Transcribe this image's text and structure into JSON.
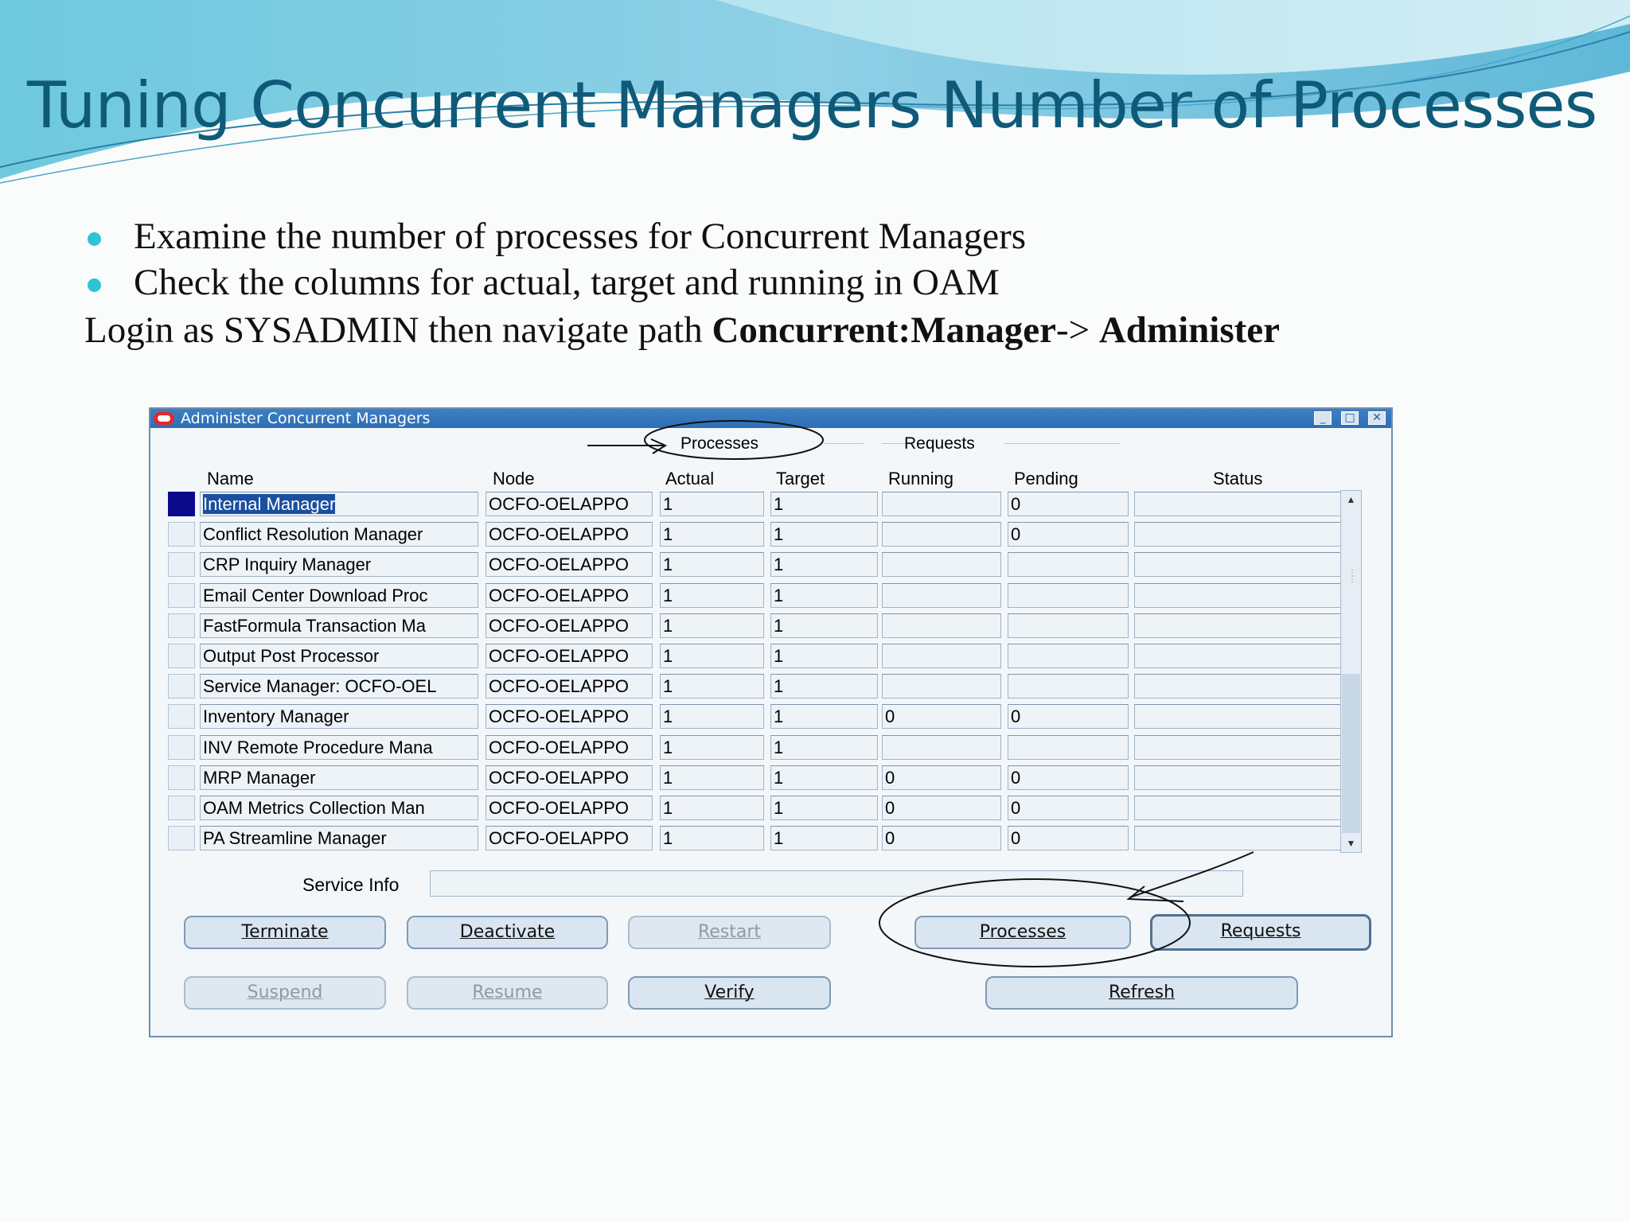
{
  "slide": {
    "title": "Tuning Concurrent Managers Number of Processes",
    "bullets": [
      "Examine the number of processes for Concurrent Managers",
      "Check  the columns for actual, target and running in OAM"
    ],
    "login_prefix": "Login as SYSADMIN then navigate path ",
    "login_bold1": "Concurrent:Manager",
    "login_arrow": "-> ",
    "login_bold2": "Administer"
  },
  "window": {
    "title": "Administer Concurrent Managers",
    "controls": {
      "minimize": "_",
      "maximize": "□",
      "close": "✕"
    }
  },
  "groups": {
    "processes": "Processes",
    "requests": "Requests"
  },
  "columns": {
    "name": "Name",
    "node": "Node",
    "actual": "Actual",
    "target": "Target",
    "running": "Running",
    "pending": "Pending",
    "status": "Status"
  },
  "rows": [
    {
      "name": "Internal Manager",
      "node": "OCFO-OELAPPO",
      "actual": "1",
      "target": "1",
      "running": "",
      "pending": "0",
      "status": ""
    },
    {
      "name": "Conflict Resolution Manager",
      "node": "OCFO-OELAPPO",
      "actual": "1",
      "target": "1",
      "running": "",
      "pending": "0",
      "status": ""
    },
    {
      "name": "CRP Inquiry Manager",
      "node": "OCFO-OELAPPO",
      "actual": "1",
      "target": "1",
      "running": "",
      "pending": "",
      "status": ""
    },
    {
      "name": "Email Center Download Proc",
      "node": "OCFO-OELAPPO",
      "actual": "1",
      "target": "1",
      "running": "",
      "pending": "",
      "status": ""
    },
    {
      "name": "FastFormula Transaction Ma",
      "node": "OCFO-OELAPPO",
      "actual": "1",
      "target": "1",
      "running": "",
      "pending": "",
      "status": ""
    },
    {
      "name": "Output Post Processor",
      "node": "OCFO-OELAPPO",
      "actual": "1",
      "target": "1",
      "running": "",
      "pending": "",
      "status": ""
    },
    {
      "name": "Service Manager: OCFO-OEL",
      "node": "OCFO-OELAPPO",
      "actual": "1",
      "target": "1",
      "running": "",
      "pending": "",
      "status": ""
    },
    {
      "name": "Inventory Manager",
      "node": "OCFO-OELAPPO",
      "actual": "1",
      "target": "1",
      "running": "0",
      "pending": "0",
      "status": ""
    },
    {
      "name": "INV Remote Procedure Mana",
      "node": "OCFO-OELAPPO",
      "actual": "1",
      "target": "1",
      "running": "",
      "pending": "",
      "status": ""
    },
    {
      "name": "MRP Manager",
      "node": "OCFO-OELAPPO",
      "actual": "1",
      "target": "1",
      "running": "0",
      "pending": "0",
      "status": ""
    },
    {
      "name": "OAM Metrics Collection Man",
      "node": "OCFO-OELAPPO",
      "actual": "1",
      "target": "1",
      "running": "0",
      "pending": "0",
      "status": ""
    },
    {
      "name": "PA Streamline Manager",
      "node": "OCFO-OELAPPO",
      "actual": "1",
      "target": "1",
      "running": "0",
      "pending": "0",
      "status": ""
    }
  ],
  "service_info": {
    "label": "Service Info",
    "value": ""
  },
  "buttons": {
    "terminate": "Terminate",
    "deactivate": "Deactivate",
    "restart": "Restart",
    "processes": "Processes",
    "requests": "Requests",
    "suspend": "Suspend",
    "resume": "Resume",
    "verify": "Verify",
    "refresh": "Refresh"
  },
  "colors": {
    "title": "#0f5a78",
    "bullet": "#2ec4d6",
    "titlebar": "#2d6fb6",
    "selected": "#0a0a8a"
  }
}
